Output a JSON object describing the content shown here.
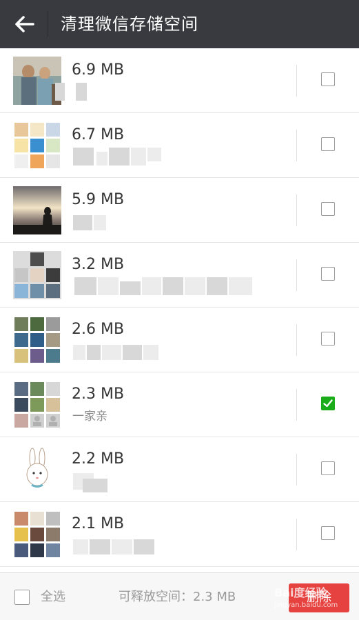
{
  "header": {
    "title": "清理微信存储空间",
    "back_icon": "arrow-left-icon"
  },
  "rows": [
    {
      "size": "6.9 MB",
      "name": "",
      "checked": false,
      "thumb": "photo"
    },
    {
      "size": "6.7 MB",
      "name": "",
      "checked": false,
      "thumb": "grid"
    },
    {
      "size": "5.9 MB",
      "name": "",
      "checked": false,
      "thumb": "sunset"
    },
    {
      "size": "3.2 MB",
      "name": "",
      "checked": false,
      "thumb": "grid"
    },
    {
      "size": "2.6 MB",
      "name": "",
      "checked": false,
      "thumb": "grid"
    },
    {
      "size": "2.3 MB",
      "name": "一家亲",
      "checked": true,
      "thumb": "grid"
    },
    {
      "size": "2.2 MB",
      "name": "",
      "checked": false,
      "thumb": "rabbit"
    },
    {
      "size": "2.1 MB",
      "name": "",
      "checked": false,
      "thumb": "grid"
    }
  ],
  "footer": {
    "select_all_label": "全选",
    "free_space_label": "可释放空间：2.3 MB",
    "delete_label": "删除",
    "watermark": "Bai度经验",
    "watermark_sub": "jingyan.baidu.com"
  },
  "colors": {
    "titlebar": "#393a3f",
    "checked": "#1aad19",
    "delete": "#e64340"
  }
}
